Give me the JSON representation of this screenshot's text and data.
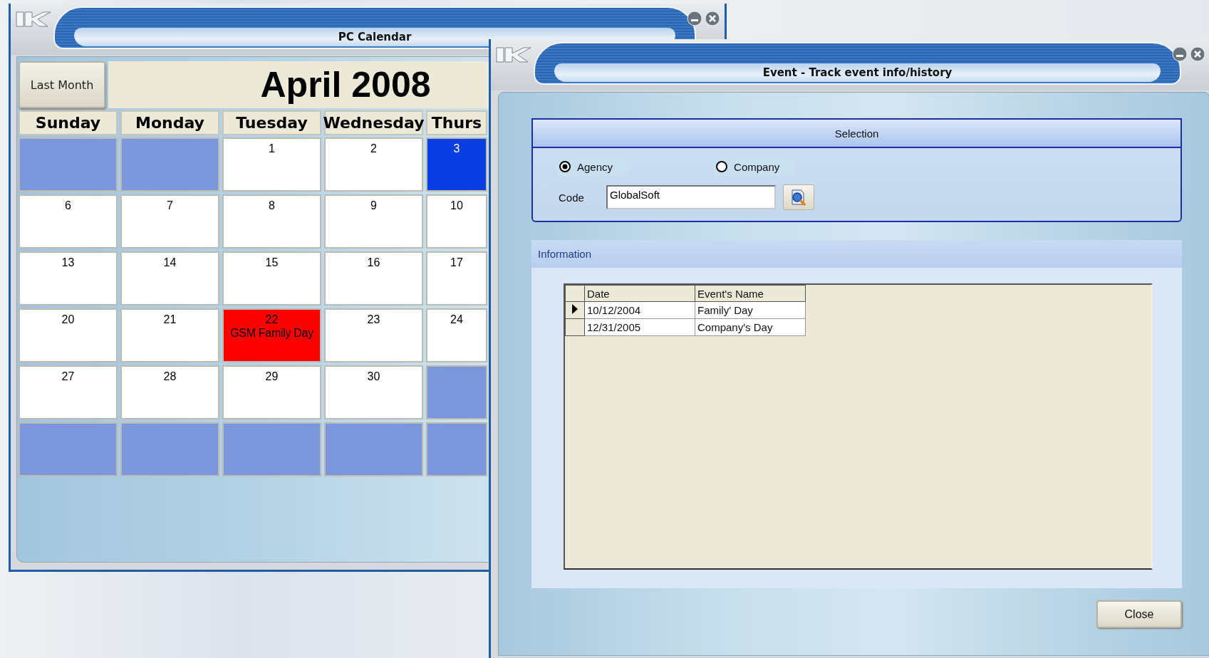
{
  "calendar_window": {
    "title": "PC Calendar",
    "prev_button": "Last Month",
    "month_title": "April 2008",
    "weekdays": [
      "Sunday",
      "Monday",
      "Tuesday",
      "Wednesday",
      "Thurs"
    ],
    "weeks": [
      [
        {
          "kind": "outside"
        },
        {
          "kind": "outside"
        },
        {
          "kind": "day",
          "label": "1"
        },
        {
          "kind": "day",
          "label": "2"
        },
        {
          "kind": "today",
          "label": "3"
        }
      ],
      [
        {
          "kind": "day",
          "label": "6"
        },
        {
          "kind": "day",
          "label": "7"
        },
        {
          "kind": "day",
          "label": "8"
        },
        {
          "kind": "day",
          "label": "9"
        },
        {
          "kind": "day",
          "label": "10"
        }
      ],
      [
        {
          "kind": "day",
          "label": "13"
        },
        {
          "kind": "day",
          "label": "14"
        },
        {
          "kind": "day",
          "label": "15"
        },
        {
          "kind": "day",
          "label": "16"
        },
        {
          "kind": "day",
          "label": "17"
        }
      ],
      [
        {
          "kind": "day",
          "label": "20"
        },
        {
          "kind": "day",
          "label": "21"
        },
        {
          "kind": "event",
          "label": "22",
          "event": "GSM Family Day"
        },
        {
          "kind": "day",
          "label": "23"
        },
        {
          "kind": "day",
          "label": "24"
        }
      ],
      [
        {
          "kind": "day",
          "label": "27"
        },
        {
          "kind": "day",
          "label": "28"
        },
        {
          "kind": "day",
          "label": "29"
        },
        {
          "kind": "day",
          "label": "30"
        },
        {
          "kind": "outside"
        }
      ],
      [
        {
          "kind": "outside"
        },
        {
          "kind": "outside"
        },
        {
          "kind": "outside"
        },
        {
          "kind": "outside"
        },
        {
          "kind": "outside"
        }
      ]
    ]
  },
  "event_window": {
    "title": "Event - Track event info/history",
    "selection": {
      "title": "Selection",
      "options": [
        {
          "label": "Agency",
          "selected": true
        },
        {
          "label": "Company",
          "selected": false
        }
      ],
      "code_label": "Code",
      "code_value": "GlobalSoft"
    },
    "information": {
      "title": "Information",
      "columns": [
        "Date",
        "Event's Name"
      ],
      "rows": [
        {
          "cells": [
            "10/12/2004",
            "Family' Day"
          ],
          "selected": true
        },
        {
          "cells": [
            "12/31/2005",
            "Company's Day"
          ],
          "selected": false
        }
      ]
    },
    "buttons": [
      "Close"
    ]
  }
}
